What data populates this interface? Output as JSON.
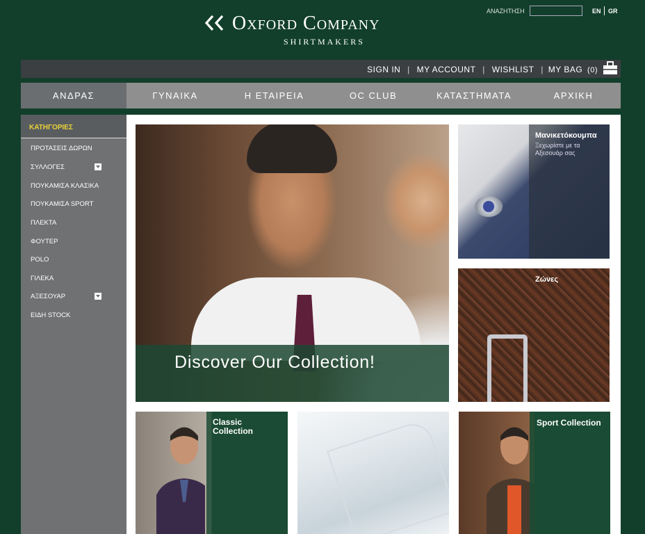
{
  "header": {
    "brand": "Oxford Company",
    "tagline": "Shirtmakers",
    "search_label": "ΑΝΑΖΗΤΗΣΗ",
    "search_value": "",
    "lang_en": "EN",
    "lang_gr": "GR"
  },
  "account_bar": {
    "sign_in": "SIGN IN",
    "my_account": "MY ACCOUNT",
    "wishlist": "WISHLIST",
    "my_bag": "MY BAG",
    "bag_count": "(0)",
    "separator": "|"
  },
  "nav": {
    "items": [
      {
        "label": "ΑΝΔΡΑΣ",
        "active": true
      },
      {
        "label": "ΓΥΝΑΙΚΑ",
        "active": false
      },
      {
        "label": "Η ΕΤΑΙΡΕΙΑ",
        "active": false
      },
      {
        "label": "OC CLUB",
        "active": false
      },
      {
        "label": "ΚΑΤΑΣΤΗΜΑΤΑ",
        "active": false
      },
      {
        "label": "ΑΡΧΙΚΗ",
        "active": false
      }
    ]
  },
  "sidebar": {
    "header": "ΚΑΤΗΓΟΡΙΕΣ",
    "items": [
      {
        "label": "ΠΡΟΤΑΣΕΙΣ ΔΩΡΩΝ",
        "expandable": false
      },
      {
        "label": "ΣΥΛΛΟΓΕΣ",
        "expandable": true
      },
      {
        "label": "ΠΟΥΚΑΜΙΣΑ ΚΛΑΣΙΚΑ",
        "expandable": false
      },
      {
        "label": "ΠΟΥΚΑΜΙΣΑ SPORT",
        "expandable": false
      },
      {
        "label": "ΠΛΕΚΤΑ",
        "expandable": false
      },
      {
        "label": "ΦΟΥΤΕΡ",
        "expandable": false
      },
      {
        "label": "POLO",
        "expandable": false
      },
      {
        "label": "ΓΙΛΕΚΑ",
        "expandable": false
      },
      {
        "label": "ΑΞΕΣΟΥΑΡ",
        "expandable": true
      },
      {
        "label": "ΕΙΔΗ STOCK",
        "expandable": false
      }
    ]
  },
  "tiles": {
    "hero_text": "Discover Our Collection!",
    "cufflinks_title": "Μανικετόκουμπα",
    "cufflinks_sub": "Ξεχωρίστε με τα Αξεσουάρ σας",
    "belts_title": "Ζώνες",
    "classic_title": "Classic Collection",
    "sport_title": "Sport Collection"
  },
  "colors": {
    "background": "#123f2c",
    "sidebar_header_text": "#e8d33a",
    "nav_bg": "#8f8f8f",
    "nav_active": "#6b6e70"
  }
}
